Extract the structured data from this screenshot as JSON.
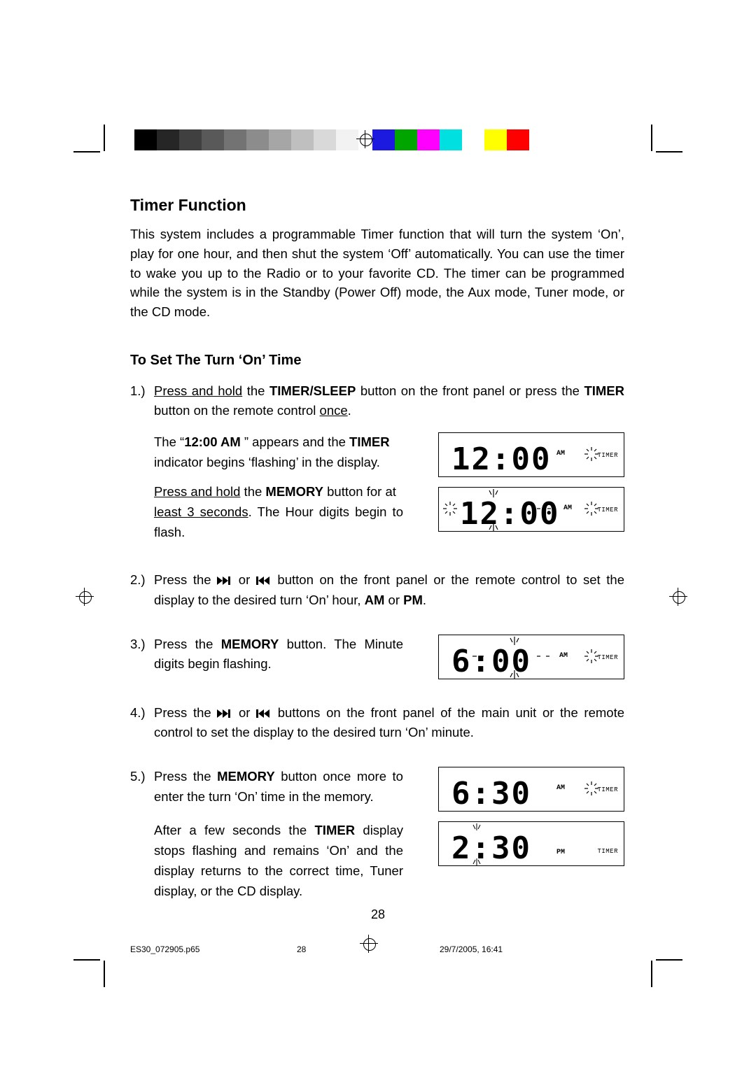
{
  "colorbar": [
    "#000000",
    "#262626",
    "#404040",
    "#595959",
    "#737373",
    "#8c8c8c",
    "#a6a6a6",
    "#bfbfbf",
    "#d9d9d9",
    "#f2f2f2",
    "#00a0e3",
    "#e6007e",
    "#ffed00",
    "#009640",
    "#e30613",
    "#2e3192"
  ],
  "title": "Timer Function",
  "intro": "This system includes a programmable Timer function that will turn the system ‘On’, play for one hour, and then shut the system ‘Off’ automatically. You can use the timer to wake you up to the Radio or to your favorite CD. The timer can be programmed while the system is in the Standby (Power Off) mode, the Aux mode, Tuner mode, or the CD mode.",
  "subtitle": "To Set The Turn ‘On’ Time",
  "steps": {
    "s1": {
      "num": "1.)",
      "p1a": "Press and hold",
      "p1b": " the ",
      "p1c": "TIMER/SLEEP",
      "p1d": " button on the front panel or press the ",
      "p1e": "TIMER",
      "p2a": "button on the remote control ",
      "p2b": "once",
      "p2c": ".",
      "p3a": "The “",
      "p3b": "12:00 AM",
      "p3c": " ” appears and the ",
      "p3d": "TIMER",
      "p4": "indicator begins ‘flashing’ in the display.",
      "p5a": "Press and hold",
      "p5b": " the ",
      "p5c": "MEMORY",
      "p5d": " button for at",
      "p6a": "least 3 seconds",
      "p6b": ". The Hour digits begin to flash."
    },
    "s2": {
      "num": "2.)",
      "a": "Press the ",
      "b": " or ",
      "c": " button on the front panel or the remote control to set the display to the desired turn ‘On’ hour, ",
      "d": "AM",
      "e": " or ",
      "f": "PM",
      "g": "."
    },
    "s3": {
      "num": "3.)",
      "a": "Press the ",
      "b": "MEMORY",
      "c": " button. The Minute digits begin flashing."
    },
    "s4": {
      "num": "4.)",
      "a": "Press the ",
      "b": " or ",
      "c": " buttons on the front panel of the main unit or the remote control to set the display to the desired turn ‘On’ minute."
    },
    "s5": {
      "num": "5.)",
      "a": "Press the ",
      "b": "MEMORY",
      "c": " button once more to enter the turn ‘On’ time in the memory.",
      "d": "After a few seconds the ",
      "e": "TIMER",
      "f": " display stops flashing and remains ‘On’ and the display returns to the correct time, Tuner display, or the CD display."
    }
  },
  "lcd": {
    "d1": {
      "time": "12:00",
      "ampm": "AM",
      "label": "TIMER"
    },
    "d2": {
      "time": "12:00",
      "ampm": "AM",
      "label": "TIMER"
    },
    "d3": {
      "time": "6:00",
      "ampm": "AM",
      "label": "TIMER"
    },
    "d4": {
      "time": "6:30",
      "ampm": "AM",
      "label": "TIMER"
    },
    "d5": {
      "time": "2:30",
      "ampm": "PM",
      "label": "TIMER"
    }
  },
  "pagenum": "28",
  "footer": {
    "file": "ES30_072905.p65",
    "page": "28",
    "date": "29/7/2005, 16:41"
  }
}
